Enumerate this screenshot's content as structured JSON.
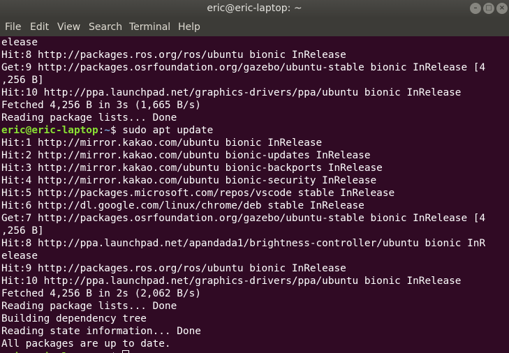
{
  "window": {
    "title": "eric@eric-laptop: ~",
    "minimize_glyph": "–",
    "maximize_glyph": "□",
    "close_glyph": "×"
  },
  "menu": [
    "File",
    "Edit",
    "View",
    "Search",
    "Terminal",
    "Help"
  ],
  "prompt": {
    "user_host": "eric@eric-laptop",
    "sep": ":",
    "path": "~",
    "symbol": "$ "
  },
  "lines_before": [
    "elease",
    "Hit:8 http://packages.ros.org/ros/ubuntu bionic InRelease",
    "Get:9 http://packages.osrfoundation.org/gazebo/ubuntu-stable bionic InRelease [4",
    ",256 B]",
    "Hit:10 http://ppa.launchpad.net/graphics-drivers/ppa/ubuntu bionic InRelease",
    "Fetched 4,256 B in 3s (1,665 B/s)",
    "Reading package lists... Done"
  ],
  "command": "sudo apt update",
  "lines_after": [
    "Hit:1 http://mirror.kakao.com/ubuntu bionic InRelease",
    "Hit:2 http://mirror.kakao.com/ubuntu bionic-updates InRelease",
    "Hit:3 http://mirror.kakao.com/ubuntu bionic-backports InRelease",
    "Hit:4 http://mirror.kakao.com/ubuntu bionic-security InRelease",
    "Hit:5 http://packages.microsoft.com/repos/vscode stable InRelease",
    "Hit:6 http://dl.google.com/linux/chrome/deb stable InRelease",
    "Get:7 http://packages.osrfoundation.org/gazebo/ubuntu-stable bionic InRelease [4",
    ",256 B]",
    "Hit:8 http://ppa.launchpad.net/apandada1/brightness-controller/ubuntu bionic InR",
    "elease",
    "Hit:9 http://packages.ros.org/ros/ubuntu bionic InRelease",
    "Hit:10 http://ppa.launchpad.net/graphics-drivers/ppa/ubuntu bionic InRelease",
    "Fetched 4,256 B in 2s (2,062 B/s)",
    "Reading package lists... Done",
    "Building dependency tree",
    "Reading state information... Done",
    "All packages are up to date."
  ],
  "colors": {
    "background": "#300a24",
    "foreground": "#ffffff",
    "prompt_user": "#8ae234",
    "prompt_path": "#729fcf",
    "titlebar": "#3c3b37"
  }
}
